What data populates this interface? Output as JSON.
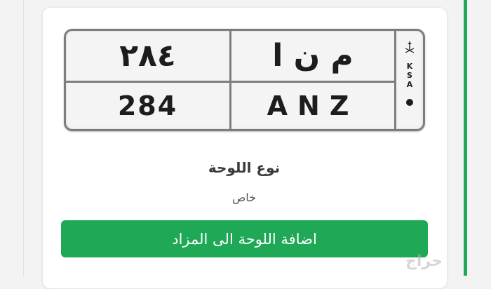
{
  "plate": {
    "arabic_numbers": "٢٨٤",
    "arabic_letters": "م ن ا",
    "english_numbers": "284",
    "english_letters": "ANZ",
    "country_code": [
      "K",
      "S",
      "A"
    ]
  },
  "plate_type": {
    "title": "نوع اللوحة",
    "value": "خاص"
  },
  "actions": {
    "add_to_auction": "اضافة اللوحة الى المزاد"
  },
  "watermark": "حراج",
  "colors": {
    "accent": "#1fa855",
    "plate_border": "#7d7d7d"
  },
  "icons": [
    "saudi-emblem-icon"
  ]
}
